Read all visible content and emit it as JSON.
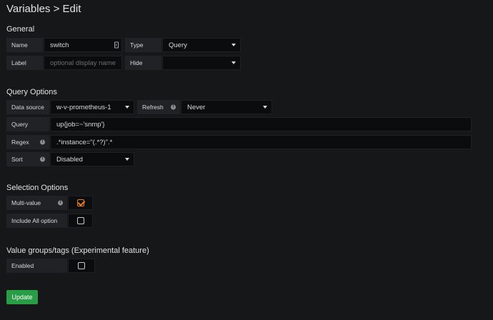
{
  "header": {
    "title": "Variables > Edit"
  },
  "general": {
    "section_title": "General",
    "name_label": "Name",
    "name_value": "switch",
    "type_label": "Type",
    "type_value": "Query",
    "label_label": "Label",
    "label_placeholder": "optional display name",
    "hide_label": "Hide",
    "hide_value": ""
  },
  "query_options": {
    "section_title": "Query Options",
    "datasource_label": "Data source",
    "datasource_value": "w-v-prometheus-1",
    "refresh_label": "Refresh",
    "refresh_value": "Never",
    "query_label": "Query",
    "query_value": "up{job=~'snmp'}",
    "regex_label": "Regex",
    "regex_value": ".*instance=\"(.*?)\".*",
    "sort_label": "Sort",
    "sort_value": "Disabled"
  },
  "selection_options": {
    "section_title": "Selection Options",
    "multi_value_label": "Multi-value",
    "multi_value_checked": true,
    "include_all_label": "Include All option",
    "include_all_checked": false
  },
  "value_groups": {
    "section_title": "Value groups/tags (Experimental feature)",
    "enabled_label": "Enabled",
    "enabled_checked": false
  },
  "actions": {
    "update_label": "Update"
  },
  "colors": {
    "accent_orange": "#eb7b18",
    "update_green": "#299c46"
  },
  "icons": {
    "info": "info-icon",
    "caret": "caret-down-icon",
    "keyboard": "keyboard-icon",
    "check": "check-icon"
  }
}
